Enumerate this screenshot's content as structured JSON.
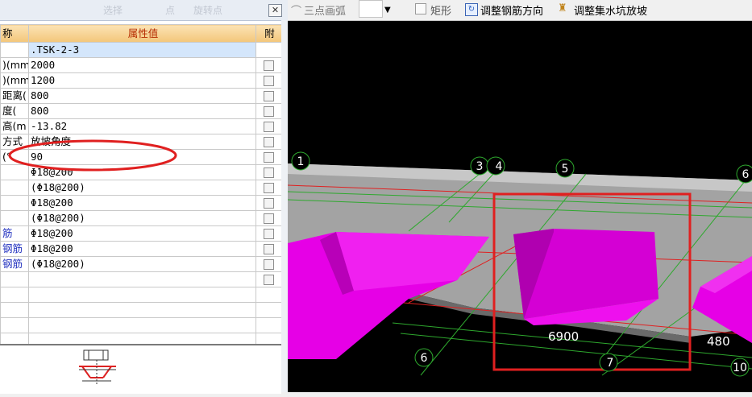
{
  "toolbar": {
    "arc_label": "三点画弧",
    "rect_label": "矩形",
    "adjust_rebar_label": "调整钢筋方向",
    "adjust_pit_label": "调整集水坑放坡"
  },
  "panel": {
    "ghost_text": [
      "选择",
      "点",
      "旋转点"
    ],
    "close_glyph": "✕",
    "header": {
      "name": "称",
      "value": "属性值",
      "attach": "附"
    },
    "rows": [
      {
        "name": "",
        "value": ".TSK-2-3",
        "check": false,
        "selected": true
      },
      {
        "name": ")(mm",
        "value": "2000",
        "check": true
      },
      {
        "name": ")(mm",
        "value": "1200",
        "check": true
      },
      {
        "name": "距离(",
        "value": "800",
        "check": true
      },
      {
        "name": "度(",
        "value": "800",
        "check": true
      },
      {
        "name": "高(m",
        "value": "-13.82",
        "check": true
      },
      {
        "name": "方式",
        "value": "放坡角度",
        "check": true
      },
      {
        "name": "(°",
        "value": "90",
        "check": true
      },
      {
        "name": "",
        "value": "Φ18@200",
        "check": true
      },
      {
        "name": "",
        "value": "(Φ18@200)",
        "check": true
      },
      {
        "name": "",
        "value": "Φ18@200",
        "check": true
      },
      {
        "name": "",
        "value": "(Φ18@200)",
        "check": true
      },
      {
        "name": "筋",
        "value": "Φ18@200",
        "check": true,
        "blue": true
      },
      {
        "name": "钢筋",
        "value": "Φ18@200",
        "check": true,
        "blue": true
      },
      {
        "name": "钢筋",
        "value": "(Φ18@200)",
        "check": true,
        "blue": true
      },
      {
        "name": "",
        "value": "",
        "check": true
      },
      {
        "name": "",
        "value": "",
        "check": false
      },
      {
        "name": "",
        "value": "",
        "check": false
      },
      {
        "name": "",
        "value": "",
        "check": false
      },
      {
        "name": "",
        "value": "",
        "check": false
      }
    ]
  },
  "viewport": {
    "axis_labels": [
      "1",
      "3",
      "4",
      "5",
      "6",
      "6",
      "7",
      "10"
    ],
    "dimension_labels": [
      "6900",
      "480"
    ]
  },
  "colors": {
    "pit": "#e600e6",
    "highlight_red": "#e02020",
    "grid_green": "#2ea82e",
    "slab_gray": "#a5a5a5"
  }
}
